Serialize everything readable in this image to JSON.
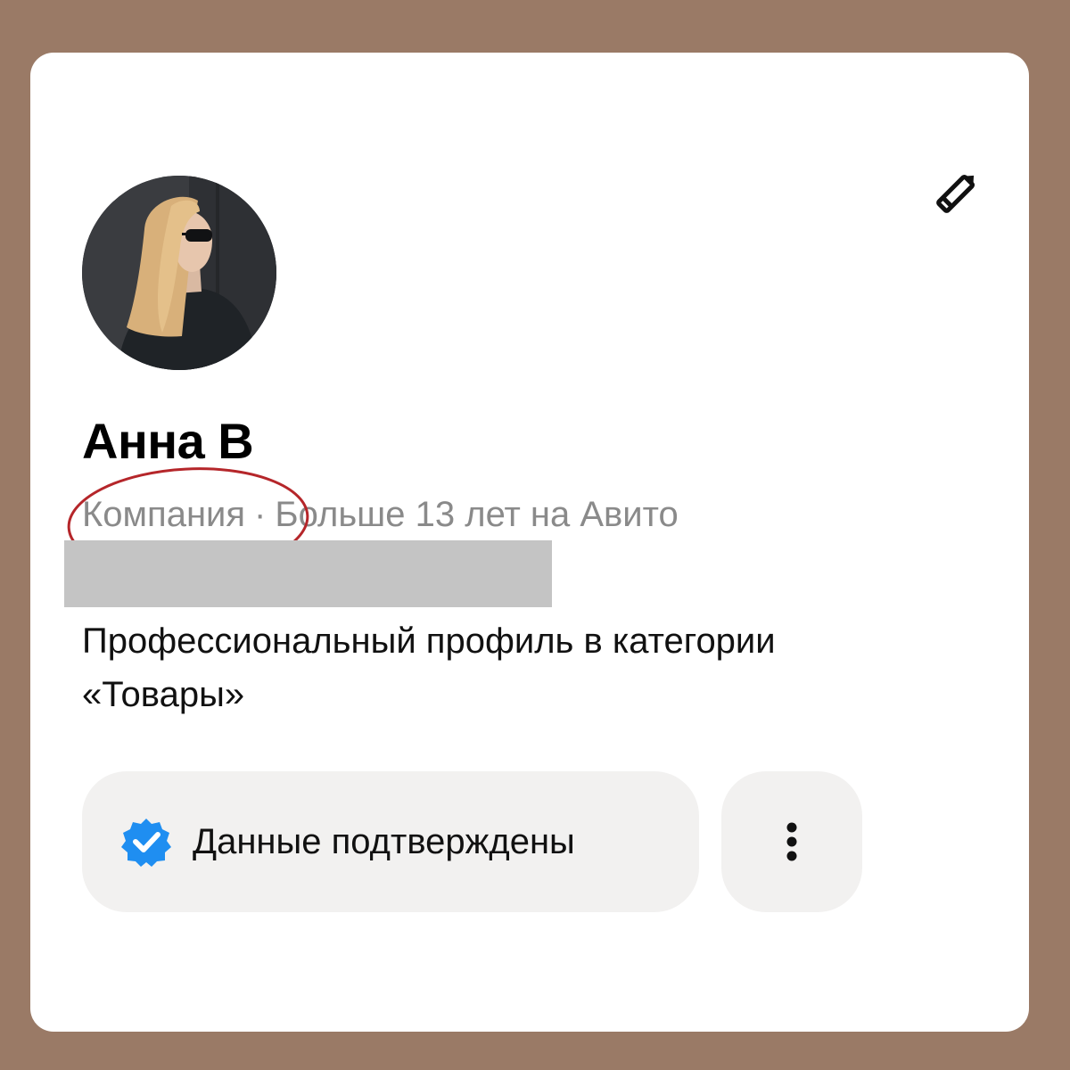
{
  "profile": {
    "name": "Анна В",
    "account_type": "Компания",
    "separator": "·",
    "tenure": "Больше 13 лет на Авито",
    "description": "Профессиональный профиль в категории «Товары»",
    "avatar_alt": "Фото профиля"
  },
  "actions": {
    "edit_icon": "pencil-icon",
    "verified_label": "Данные подтверждены",
    "verified_icon": "verified-badge-icon",
    "more_icon": "vertical-dots-icon"
  },
  "colors": {
    "background": "#9a7a66",
    "card": "#ffffff",
    "muted_text": "#8a8a8a",
    "button_bg": "#f2f1f0",
    "verified_blue": "#1f8ef1",
    "highlight_red": "#b5262a",
    "redaction_gray": "#c4c4c4"
  }
}
